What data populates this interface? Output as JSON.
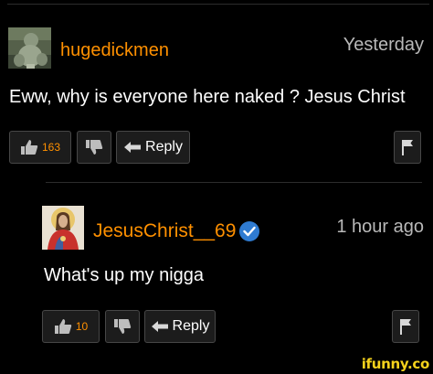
{
  "comments": [
    {
      "username": "hugedickmen",
      "timestamp": "Yesterday",
      "text": "Eww, why is everyone here naked ? Jesus Christ",
      "likes": "163",
      "reply_label": "Reply",
      "verified": false
    },
    {
      "username": "JesusChrist__69",
      "timestamp": "1 hour ago",
      "text": "What's up my nigga",
      "likes": "10",
      "reply_label": "Reply",
      "verified": true
    }
  ],
  "watermark": "ifunny.co",
  "colors": {
    "username": "#ff9000",
    "like_count": "#ff9000",
    "verified_badge": "#2f7bd1",
    "background": "#000000"
  },
  "icons": [
    "thumbs-up-icon",
    "thumbs-down-icon",
    "reply-arrow-icon",
    "flag-icon",
    "verified-check-icon"
  ]
}
